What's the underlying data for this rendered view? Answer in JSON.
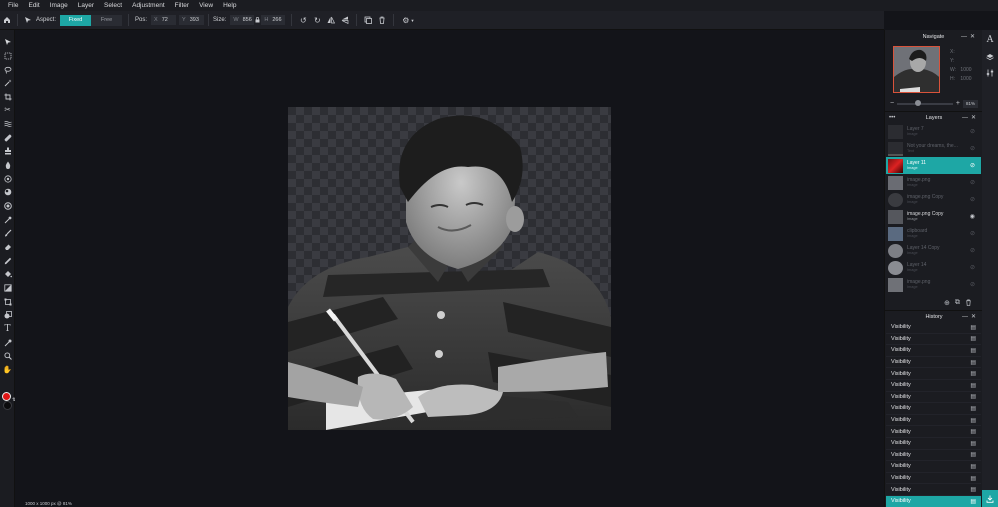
{
  "menu": [
    "File",
    "Edit",
    "Image",
    "Layer",
    "Select",
    "Adjustment",
    "Filter",
    "View",
    "Help"
  ],
  "toolbar": {
    "aspect_label": "Aspect:",
    "fixed_label": "Fixed",
    "free_label": "Free",
    "pos_label": "Pos:",
    "pos_x_label": "X",
    "pos_x": "72",
    "pos_y_label": "Y",
    "pos_y": "393",
    "size_label": "Size:",
    "size_w_label": "W",
    "size_w": "856",
    "size_h_label": "H",
    "size_h": "266"
  },
  "status": "1000 x 1000 px @ 81%",
  "colors": {
    "foreground": "#e01515",
    "background": "#0b0b0d",
    "accent": "#1ea7a5"
  },
  "navigator": {
    "title": "Navigate",
    "x_label": "X:",
    "y_label": "Y:",
    "w_label": "W:",
    "w_value": "1000",
    "h_label": "H:",
    "h_value": "1000",
    "zoom": "81%"
  },
  "layers": {
    "title": "Layers",
    "items": [
      {
        "name": "Layer 7",
        "type": "Image"
      },
      {
        "name": "Not your dreams, the...",
        "type": "Text"
      },
      {
        "name": "Layer 11",
        "type": "Image"
      },
      {
        "name": "image.png",
        "type": "Image"
      },
      {
        "name": "image.png Copy",
        "type": "Image"
      },
      {
        "name": "image.png Copy",
        "type": "Image"
      },
      {
        "name": "clipboard",
        "type": "Image"
      },
      {
        "name": "Layer 14 Copy",
        "type": "Image"
      },
      {
        "name": "Layer 14",
        "type": "Image"
      },
      {
        "name": "image.png",
        "type": "Image"
      }
    ]
  },
  "history": {
    "title": "History",
    "items": [
      "Visibility",
      "Visibility",
      "Visibility",
      "Visibility",
      "Visibility",
      "Visibility",
      "Visibility",
      "Visibility",
      "Visibility",
      "Visibility",
      "Visibility",
      "Visibility",
      "Visibility",
      "Visibility",
      "Visibility",
      "Visibility"
    ]
  }
}
